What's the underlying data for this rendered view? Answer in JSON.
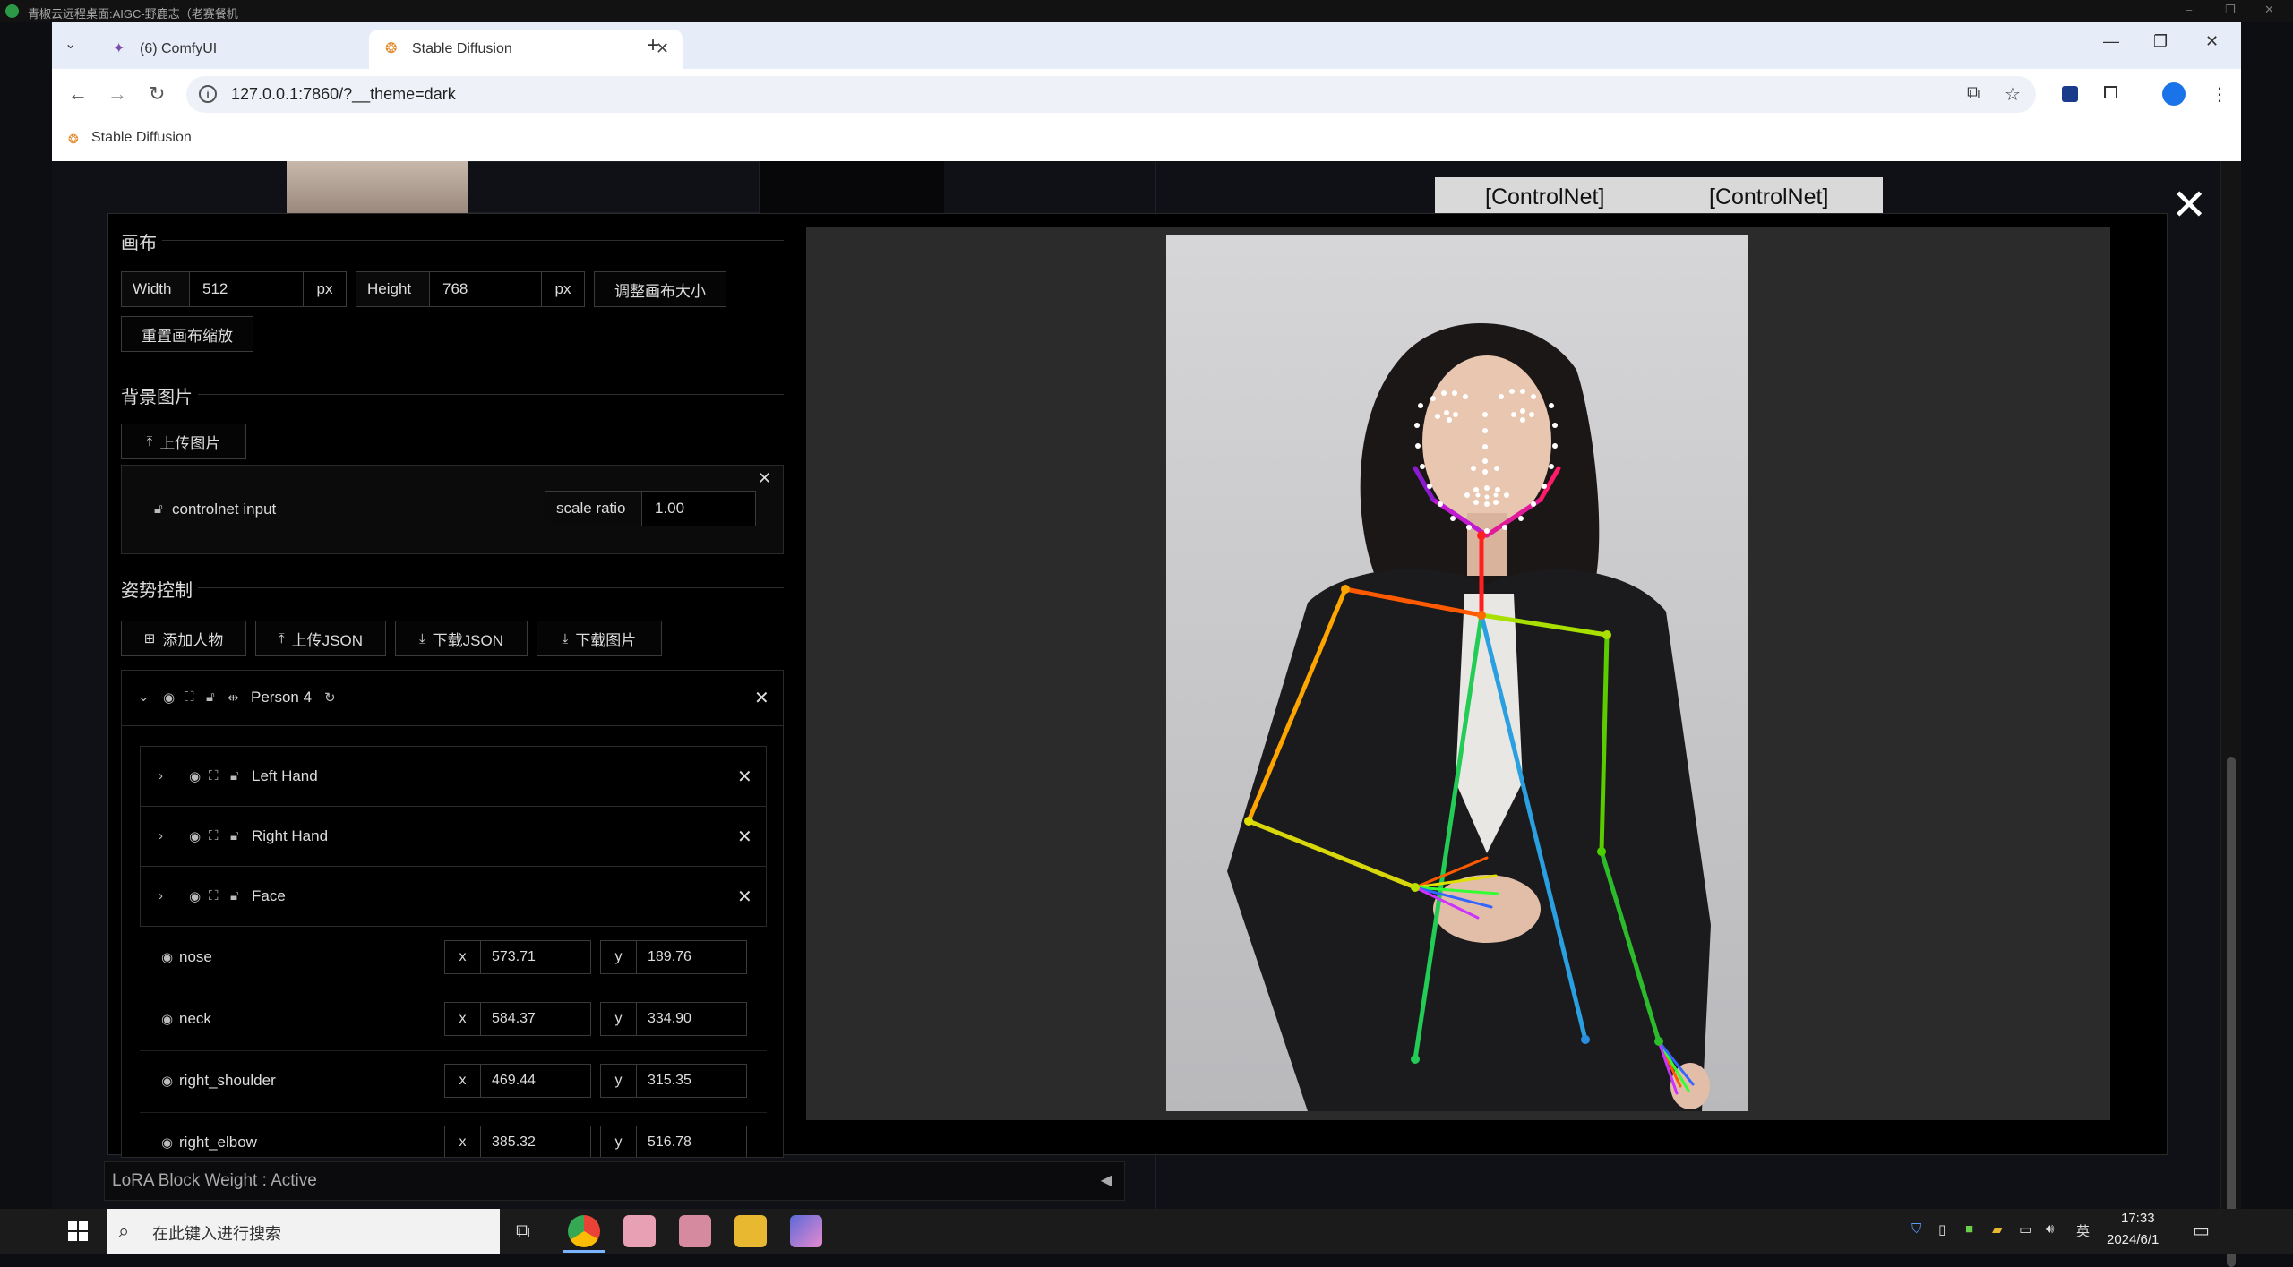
{
  "remote_desktop": {
    "title": "青椒云远程桌面:AIGC-野鹿志（老赛餐机"
  },
  "browser": {
    "tabs": [
      {
        "label": "(6) ComfyUI",
        "icon": "comfyui-icon",
        "active": false
      },
      {
        "label": "Stable Diffusion",
        "icon": "stable-diffusion-icon",
        "active": true
      }
    ],
    "url": "127.0.0.1:7860/?__theme=dark",
    "bookmark": "Stable Diffusion"
  },
  "controlnet_buttons": [
    "[ControlNet]",
    "[ControlNet]"
  ],
  "canvas_section": {
    "title": "画布",
    "width_label": "Width",
    "width_value": "512",
    "width_unit": "px",
    "height_label": "Height",
    "height_value": "768",
    "height_unit": "px",
    "resize_button": "调整画布大小",
    "reset_zoom_button": "重置画布缩放"
  },
  "background_section": {
    "title": "背景图片",
    "upload_button": "上传图片",
    "controlnet_input_label": "controlnet input",
    "scale_ratio_label": "scale ratio",
    "scale_ratio_value": "1.00"
  },
  "pose_section": {
    "title": "姿势控制",
    "add_person_button": "添加人物",
    "upload_json_button": "上传JSON",
    "download_json_button": "下载JSON",
    "download_image_button": "下载图片",
    "person_label": "Person 4",
    "sub_groups": [
      "Left Hand",
      "Right Hand",
      "Face"
    ],
    "keypoints": [
      {
        "name": "nose",
        "x": "573.71",
        "y": "189.76"
      },
      {
        "name": "neck",
        "x": "584.37",
        "y": "334.90"
      },
      {
        "name": "right_shoulder",
        "x": "469.44",
        "y": "315.35"
      },
      {
        "name": "right_elbow",
        "x": "385.32",
        "y": "516.78"
      }
    ],
    "x_label": "x",
    "y_label": "y"
  },
  "lora_bar": {
    "text": "LoRA Block Weight : Active"
  },
  "taskbar": {
    "search_placeholder": "在此键入进行搜索",
    "time": "17:33",
    "date": "2024/6/1",
    "ime": "英"
  }
}
